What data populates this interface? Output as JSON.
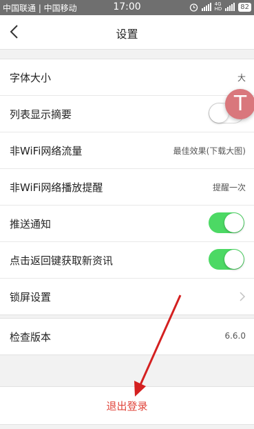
{
  "status_bar": {
    "carriers": "中国联通 | 中国移动",
    "time": "17:00",
    "network_tags": [
      "4G",
      "HD"
    ],
    "battery": "82"
  },
  "header": {
    "title": "设置",
    "back_icon": "chevron-left-icon"
  },
  "settings": {
    "font_size": {
      "label": "字体大小",
      "value": "大"
    },
    "list_summary": {
      "label": "列表显示摘要",
      "enabled": false
    },
    "non_wifi_traffic": {
      "label": "非WiFi网络流量",
      "value": "最佳效果(下载大图)"
    },
    "non_wifi_play_reminder": {
      "label": "非WiFi网络播放提醒",
      "value": "提醒一次"
    },
    "push_notifications": {
      "label": "推送通知",
      "enabled": true
    },
    "back_key_refresh": {
      "label": "点击返回键获取新资讯",
      "enabled": true
    },
    "lock_screen": {
      "label": "锁屏设置"
    }
  },
  "version": {
    "label": "检查版本",
    "value": "6.6.0"
  },
  "floating_button": {
    "letter": "T",
    "color": "#d9777c"
  },
  "logout": {
    "label": "退出登录",
    "color": "#e0443a"
  },
  "colors": {
    "toggle_on": "#4cd964",
    "annotation_arrow": "#d42020"
  }
}
